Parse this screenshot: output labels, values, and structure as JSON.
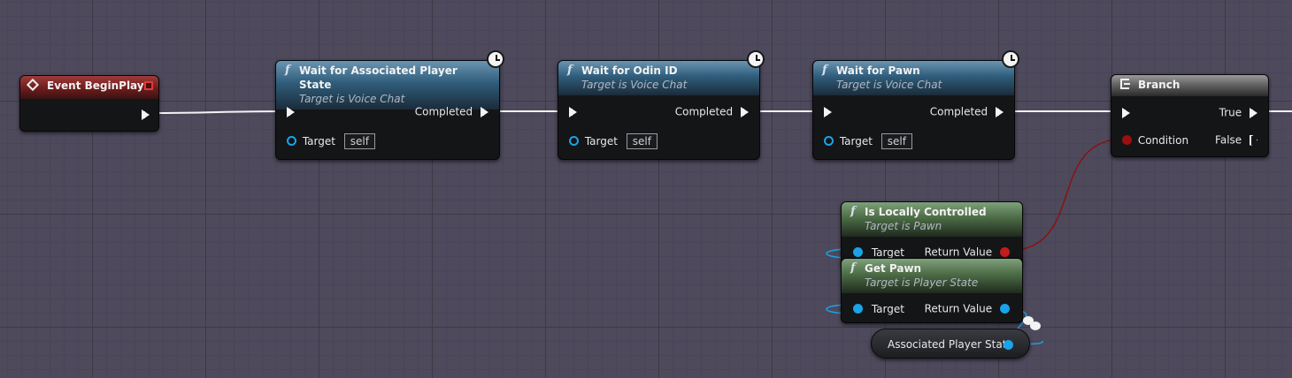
{
  "nodes": {
    "event_beginplay": {
      "title": "Event BeginPlay"
    },
    "wait_player_state": {
      "title": "Wait for Associated Player State",
      "subtitle": "Target is Voice Chat",
      "completed": "Completed",
      "target": "Target",
      "self": "self"
    },
    "wait_odin_id": {
      "title": "Wait for Odin ID",
      "subtitle": "Target is Voice Chat",
      "completed": "Completed",
      "target": "Target",
      "self": "self"
    },
    "wait_pawn": {
      "title": "Wait for Pawn",
      "subtitle": "Target is Voice Chat",
      "completed": "Completed",
      "target": "Target",
      "self": "self"
    },
    "branch": {
      "title": "Branch",
      "condition": "Condition",
      "true_label": "True",
      "false_label": "False"
    },
    "is_locally_controlled": {
      "title": "Is Locally Controlled",
      "subtitle": "Target is Pawn",
      "target": "Target",
      "return_value": "Return Value"
    },
    "get_pawn": {
      "title": "Get Pawn",
      "subtitle": "Target is Player State",
      "target": "Target",
      "return_value": "Return Value"
    },
    "associated_player_state": {
      "label": "Associated Player State"
    }
  },
  "icons": {
    "function": "f",
    "latent": "clock-icon",
    "event": "event-diamond-icon",
    "branch": "branch-icon"
  },
  "colors": {
    "exec_wire": "#f4f4f4",
    "object_pin": "#1aa3e8",
    "bool_pin": "#9a0f0f",
    "bool_wire": "#8a1212",
    "function_header": "#2f5d7b",
    "pure_header": "#4c6c46",
    "event_header": "#6e1c1c"
  }
}
